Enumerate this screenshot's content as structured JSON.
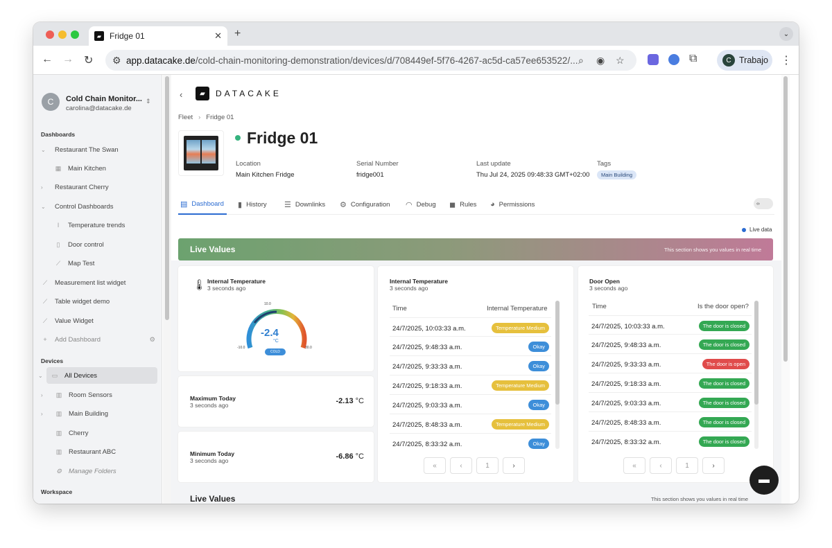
{
  "browser": {
    "tab_title": "Fridge 01",
    "url_host": "app.datacake.de",
    "url_path": "/cold-chain-monitoring-demonstration/devices/d/708449ef-5f76-4267-ac5d-ca57ee653522/...",
    "profile_initial": "C",
    "profile_label": "Trabajo"
  },
  "sidebar": {
    "account": {
      "initial": "C",
      "name": "Cold Chain Monitor...",
      "email": "carolina@datacake.de"
    },
    "dashboards_heading": "Dashboards",
    "dashboards": [
      {
        "label": "Restaurant The Swan"
      },
      {
        "label": "Main Kitchen"
      },
      {
        "label": "Restaurant Cherry"
      },
      {
        "label": "Control Dashboards"
      },
      {
        "label": "Temperature trends"
      },
      {
        "label": "Door control"
      },
      {
        "label": "Map Test"
      },
      {
        "label": "Measurement list widget"
      },
      {
        "label": "Table widget demo"
      },
      {
        "label": "Value Widget"
      },
      {
        "label": "Add Dashboard"
      }
    ],
    "devices_heading": "Devices",
    "devices": [
      {
        "label": "All Devices"
      },
      {
        "label": "Room Sensors"
      },
      {
        "label": "Main Building"
      },
      {
        "label": "Cherry"
      },
      {
        "label": "Restaurant ABC"
      },
      {
        "label": "Manage Folders"
      }
    ],
    "workspace_heading": "Workspace"
  },
  "header": {
    "brand": "DATACAKE",
    "breadcrumb": [
      "Fleet",
      "Fridge 01"
    ],
    "device_title": "Fridge 01",
    "meta": [
      {
        "label": "Location",
        "value": "Main Kitchen Fridge"
      },
      {
        "label": "Serial Number",
        "value": "fridge001"
      },
      {
        "label": "Last update",
        "value": "Thu Jul 24, 2025 09:48:33 GMT+02:00"
      },
      {
        "label": "Tags",
        "value": "Main Building"
      }
    ]
  },
  "tabs": [
    {
      "label": "Dashboard",
      "icon": "table-icon",
      "active": true
    },
    {
      "label": "History",
      "icon": "bar-chart-icon"
    },
    {
      "label": "Downlinks",
      "icon": "sliders-icon"
    },
    {
      "label": "Configuration",
      "icon": "gear-icon"
    },
    {
      "label": "Debug",
      "icon": "rss-icon"
    },
    {
      "label": "Rules",
      "icon": "chat-icon"
    },
    {
      "label": "Permissions",
      "icon": "users-icon"
    }
  ],
  "live_data_label": "Live data",
  "banner": {
    "title": "Live Values",
    "subtitle": "This section shows you values in real time"
  },
  "gauge_widget": {
    "title": "Internal Temperature",
    "subtitle": "3 seconds ago",
    "value": "-2.4",
    "unit": "°C",
    "status": "COLD",
    "min_label": "-10.0",
    "mid_label": "10.0",
    "max_label": "30.0"
  },
  "max_widget": {
    "title": "Maximum Today",
    "subtitle": "3 seconds ago",
    "value": "-2.13",
    "unit": "°C"
  },
  "min_widget": {
    "title": "Minimum Today",
    "subtitle": "3 seconds ago",
    "value": "-6.86",
    "unit": "°C"
  },
  "temp_table": {
    "title": "Internal Temperature",
    "subtitle": "3 seconds ago",
    "col_time": "Time",
    "col_value": "Internal Temperature",
    "rows": [
      {
        "time": "24/7/2025, 10:03:33 a.m.",
        "status": "Temperature Medium",
        "kind": "med"
      },
      {
        "time": "24/7/2025, 9:48:33 a.m.",
        "status": "Okay",
        "kind": "ok"
      },
      {
        "time": "24/7/2025, 9:33:33 a.m.",
        "status": "Okay",
        "kind": "ok"
      },
      {
        "time": "24/7/2025, 9:18:33 a.m.",
        "status": "Temperature Medium",
        "kind": "med"
      },
      {
        "time": "24/7/2025, 9:03:33 a.m.",
        "status": "Okay",
        "kind": "ok"
      },
      {
        "time": "24/7/2025, 8:48:33 a.m.",
        "status": "Temperature Medium",
        "kind": "med"
      },
      {
        "time": "24/7/2025, 8:33:32 a.m.",
        "status": "Okay",
        "kind": "ok"
      }
    ],
    "page": "1"
  },
  "door_table": {
    "title": "Door Open",
    "subtitle": "3 seconds ago",
    "col_time": "Time",
    "col_value": "Is the door open?",
    "rows": [
      {
        "time": "24/7/2025, 10:03:33 a.m.",
        "status": "The door is closed",
        "kind": "closed"
      },
      {
        "time": "24/7/2025, 9:48:33 a.m.",
        "status": "The door is closed",
        "kind": "closed"
      },
      {
        "time": "24/7/2025, 9:33:33 a.m.",
        "status": "The door is open",
        "kind": "open"
      },
      {
        "time": "24/7/2025, 9:18:33 a.m.",
        "status": "The door is closed",
        "kind": "closed"
      },
      {
        "time": "24/7/2025, 9:03:33 a.m.",
        "status": "The door is closed",
        "kind": "closed"
      },
      {
        "time": "24/7/2025, 8:48:33 a.m.",
        "status": "The door is closed",
        "kind": "closed"
      },
      {
        "time": "24/7/2025, 8:33:32 a.m.",
        "status": "The door is closed",
        "kind": "closed"
      }
    ],
    "page": "1"
  },
  "section2": {
    "title": "Live Values",
    "subtitle": "This section shows you values in real time"
  },
  "colors": {
    "accent": "#2a6bd1",
    "ok": "#3d8ed9",
    "medium": "#e6c03d",
    "closed": "#34a853",
    "open": "#e04b4b"
  }
}
